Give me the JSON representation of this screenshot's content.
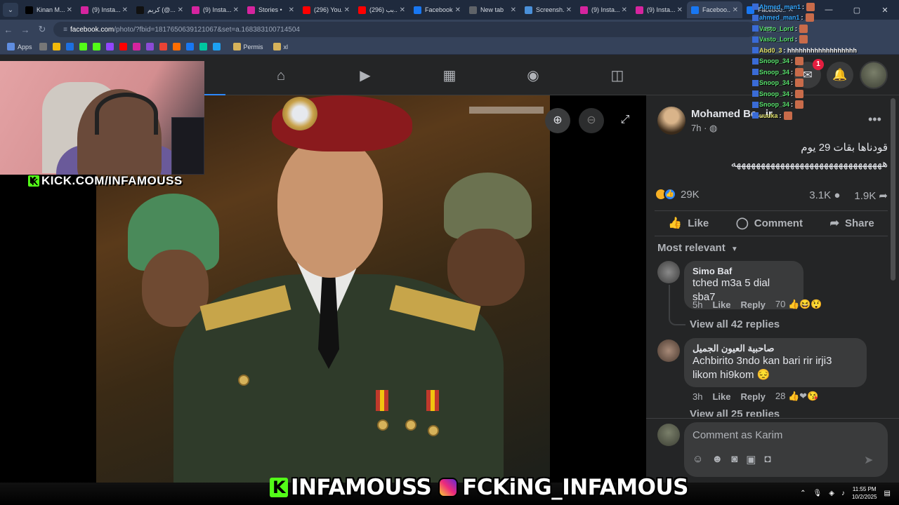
{
  "browser": {
    "tabs": [
      {
        "title": "Kinan M...",
        "fav": "#000000"
      },
      {
        "title": "(9) Insta...",
        "fav": "#d6249f"
      },
      {
        "title": "كريم (@...",
        "fav": "#111111"
      },
      {
        "title": "(9) Insta...",
        "fav": "#d6249f"
      },
      {
        "title": "Stories •",
        "fav": "#d6249f"
      },
      {
        "title": "(296) You...",
        "fav": "#ff0000"
      },
      {
        "title": "(296) بب...",
        "fav": "#ff0000"
      },
      {
        "title": "Facebook",
        "fav": "#1877f2"
      },
      {
        "title": "New tab",
        "fav": "#5f6368"
      },
      {
        "title": "Screensh...",
        "fav": "#4a90d9"
      },
      {
        "title": "(9) Insta...",
        "fav": "#d6249f"
      },
      {
        "title": "(9) Insta...",
        "fav": "#d6249f"
      },
      {
        "title": "Faceboo...",
        "fav": "#1877f2",
        "active": true
      },
      {
        "title": "Faceboo...",
        "fav": "#1877f2"
      }
    ],
    "url_host": "facebook.com",
    "url_path": "/photo/?fbid=1817650639121067&set=a.168383100714504",
    "bookmarks_apps": "Apps",
    "bookmarks_folders": [
      "Permis",
      "xl"
    ]
  },
  "stream": {
    "kick_handle": "KICK.COM/INFAMOUSS",
    "banner_left": "INFAMOUSS",
    "banner_right": "FCKiNG_INFAMOUS",
    "chat": [
      {
        "user": "Ahmed_man1",
        "msg": ":",
        "color": "#33a7ff"
      },
      {
        "user": "ahmed_man1",
        "msg": ":",
        "color": "#33a7ff"
      },
      {
        "user": "Vasto_Lord",
        "msg": ":",
        "color": "#58e26c"
      },
      {
        "user": "Vasto_Lord",
        "msg": ":",
        "color": "#58e26c"
      },
      {
        "user": "Abd0_3",
        "msg": ": hhhhhhhhhhhhhhhhhh",
        "color": "#e2e26c"
      },
      {
        "user": "Snoop_34",
        "msg": ":",
        "color": "#58e26c"
      },
      {
        "user": "Snoop_34",
        "msg": ":",
        "color": "#58e26c"
      },
      {
        "user": "Snoop_34",
        "msg": ":",
        "color": "#58e26c"
      },
      {
        "user": "Snoop_34",
        "msg": ":",
        "color": "#58e26c"
      },
      {
        "user": "Snoop_34",
        "msg": ":",
        "color": "#58e26c"
      },
      {
        "user": "uuuka",
        "msg": ":",
        "color": "#e2e26c"
      }
    ]
  },
  "fb": {
    "notif_count": "1",
    "post": {
      "author": "Mohamed Be...ir",
      "time": "7h",
      "text_line1": "قودناها بقات 29 يوم",
      "text_line2": "هههههههههههههههههههههههههههههههه",
      "reactions": "29K",
      "comments_count": "3.1K",
      "shares_count": "1.9K"
    },
    "actions": {
      "like": "Like",
      "comment": "Comment",
      "share": "Share"
    },
    "sort": "Most relevant",
    "comments": [
      {
        "name": "Simo Baf",
        "text": "tched m3a 5 dial sba7",
        "time": "5h",
        "like": "Like",
        "reply": "Reply",
        "count": "70",
        "view_replies": "View all 42 replies"
      },
      {
        "name": "صاحبية العيون الجميل",
        "text": "Achbirito 3ndo kan bari rir irji3 likom hi9kom 😔",
        "time": "3h",
        "like": "Like",
        "reply": "Reply",
        "count": "28",
        "view_replies": "View all 25 replies"
      }
    ],
    "composer_placeholder": "Comment as Karim"
  },
  "taskbar": {
    "time": "11:55 PM",
    "date": "10/2/2025"
  },
  "colors": {
    "accent": "#2d88ff",
    "kick_green": "#53fc18"
  }
}
